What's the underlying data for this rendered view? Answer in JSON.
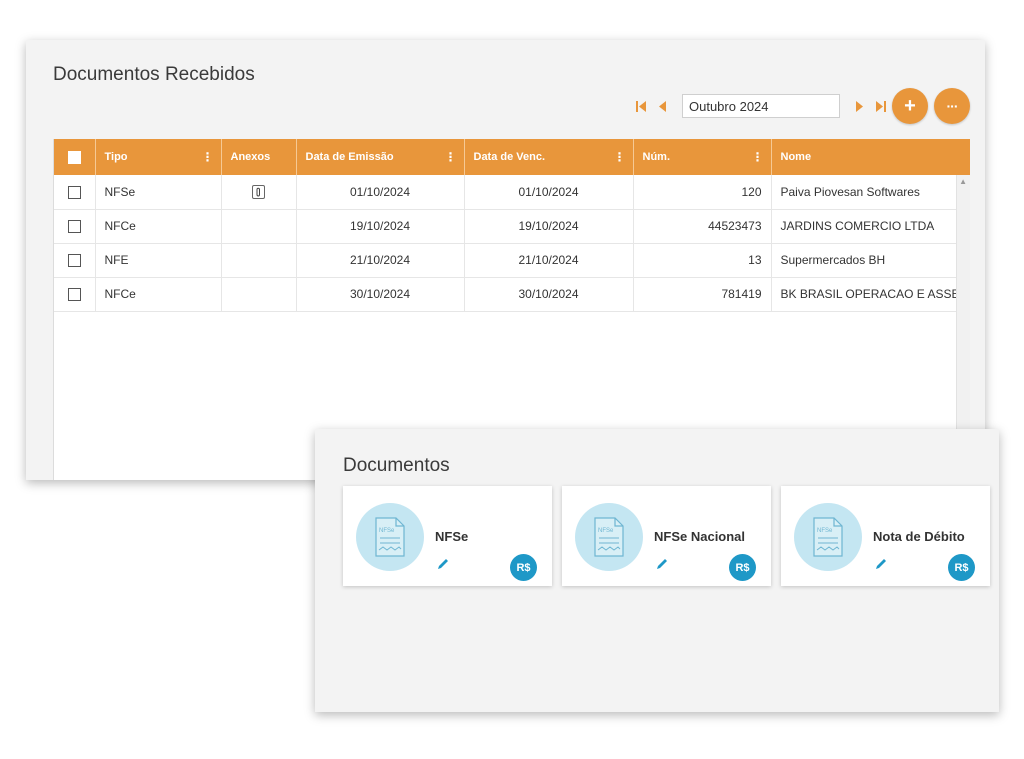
{
  "received": {
    "title": "Documentos Recebidos",
    "period": "Outubro 2024",
    "columns": [
      "Tipo",
      "Anexos",
      "Data de Emissão",
      "Data de Venc.",
      "Núm.",
      "Nome"
    ],
    "rows": [
      {
        "tipo": "NFSe",
        "anexo": true,
        "emissao": "01/10/2024",
        "venc": "01/10/2024",
        "num": "120",
        "nome": "Paiva Piovesan Softwares"
      },
      {
        "tipo": "NFCe",
        "anexo": false,
        "emissao": "19/10/2024",
        "venc": "19/10/2024",
        "num": "44523473",
        "nome": "JARDINS COMERCIO LTDA"
      },
      {
        "tipo": "NFE",
        "anexo": false,
        "emissao": "21/10/2024",
        "venc": "21/10/2024",
        "num": "13",
        "nome": "Supermercados BH"
      },
      {
        "tipo": "NFCe",
        "anexo": false,
        "emissao": "30/10/2024",
        "venc": "30/10/2024",
        "num": "781419",
        "nome": "BK BRASIL OPERACAO E ASSESSORIA"
      }
    ],
    "add_label": "+",
    "more_label": "···"
  },
  "documents": {
    "title": "Documentos",
    "cards": [
      {
        "label": "NFSe",
        "icon_text": "NFSe",
        "badge": "R$"
      },
      {
        "label": "NFSe Nacional",
        "icon_text": "NFSe",
        "badge": "R$"
      },
      {
        "label": "Nota de Débito",
        "icon_text": "NFSe",
        "badge": "R$"
      }
    ]
  },
  "colors": {
    "accent": "#e8963b",
    "blue": "#1e98c7",
    "icon_bg": "#c4e6f2"
  }
}
